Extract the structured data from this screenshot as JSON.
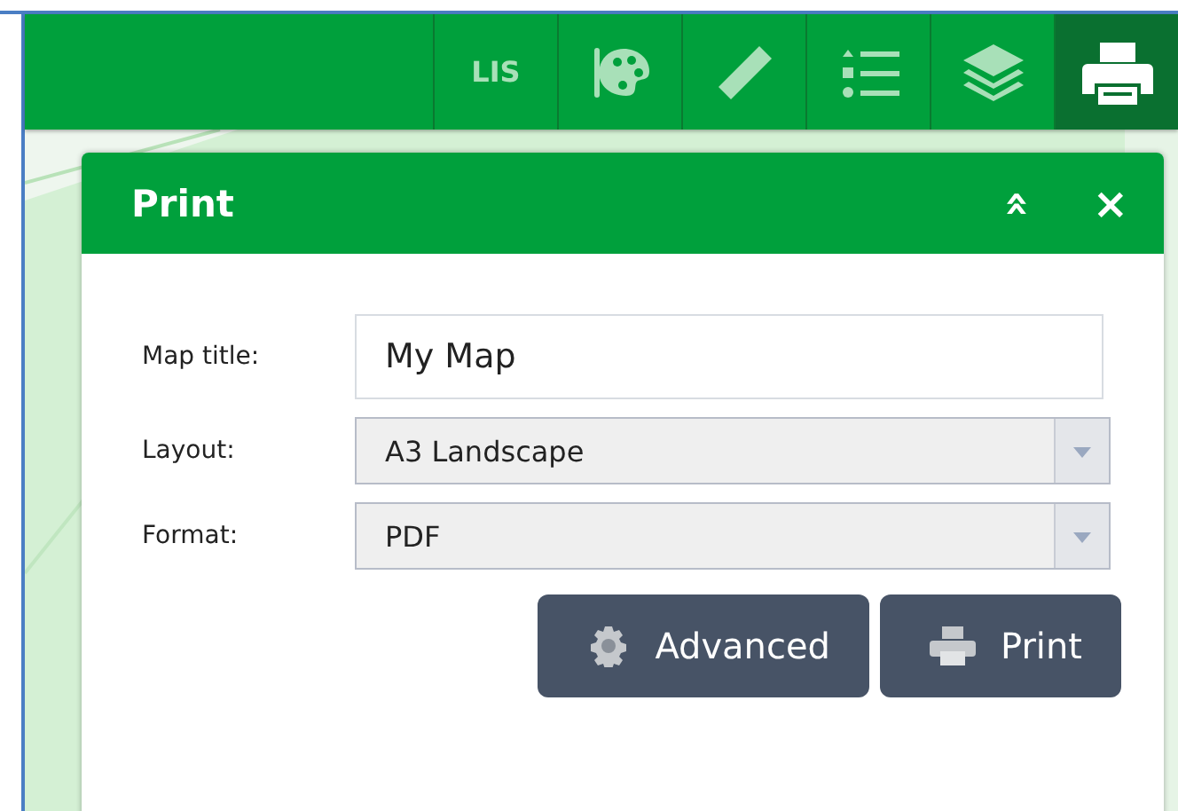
{
  "toolbar": {
    "items": [
      {
        "kind": "text",
        "label": "LIS",
        "selected": false
      },
      {
        "kind": "palette",
        "selected": false
      },
      {
        "kind": "ruler",
        "selected": false
      },
      {
        "kind": "legend",
        "selected": false
      },
      {
        "kind": "layers",
        "selected": false
      },
      {
        "kind": "printer",
        "selected": true
      }
    ]
  },
  "panel": {
    "title": "Print",
    "collapse_icon": "»",
    "close_icon": "×",
    "fields": [
      {
        "kind": "text",
        "label": "Map title:",
        "value": "My Map"
      },
      {
        "kind": "select",
        "label": "Layout:",
        "value": "A3 Landscape"
      },
      {
        "kind": "select",
        "label": "Format:",
        "value": "PDF"
      }
    ],
    "buttons": [
      {
        "kind": "gear",
        "label": "Advanced"
      },
      {
        "kind": "printer",
        "label": "Print"
      }
    ]
  }
}
